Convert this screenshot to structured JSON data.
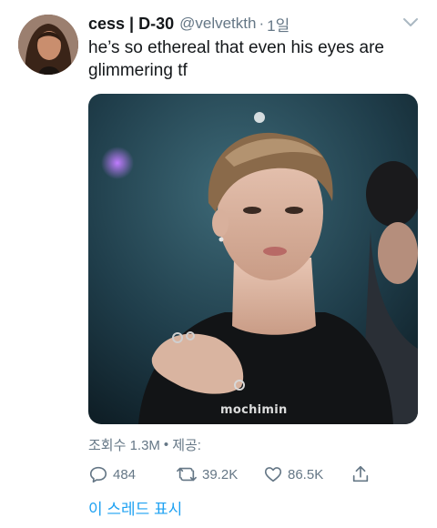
{
  "tweet": {
    "author_name": "cess | D-30",
    "handle": "@velvetkth",
    "separator": "·",
    "time": "1일",
    "text": "he’s so ethereal that even his eyes are glimmering tf",
    "media": {
      "watermark": "mochimin"
    },
    "meta": {
      "views": "조회수 1.3M",
      "bullet": "•",
      "share_label": "제공:"
    },
    "actions": {
      "replies": "484",
      "retweets": "39.2K",
      "likes": "86.5K"
    },
    "thread_link": "이 스레드 표시"
  },
  "colors": {
    "text_primary": "#14171a",
    "text_secondary": "#657786",
    "accent": "#1da1f2"
  },
  "icons": [
    "avatar-photo",
    "chevron-down-icon",
    "reply-icon",
    "retweet-icon",
    "like-icon",
    "share-icon"
  ]
}
